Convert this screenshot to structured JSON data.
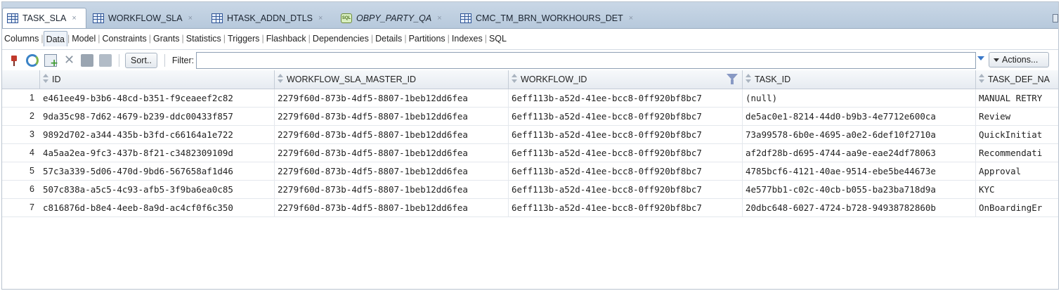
{
  "tabs": [
    {
      "label": "TASK_SLA",
      "icon": "table-grid-icon",
      "active": true
    },
    {
      "label": "WORKFLOW_SLA",
      "icon": "table-grid-icon",
      "active": false
    },
    {
      "label": "HTASK_ADDN_DTLS",
      "icon": "table-grid-icon",
      "active": false
    },
    {
      "label": "OBPY_PARTY_QA",
      "icon": "sql-worksheet-icon",
      "active": false
    },
    {
      "label": "CMC_TM_BRN_WORKHOURS_DET",
      "icon": "table-grid-icon",
      "active": false
    }
  ],
  "subtabs": [
    "Columns",
    "Data",
    "Model",
    "Constraints",
    "Grants",
    "Statistics",
    "Triggers",
    "Flashback",
    "Dependencies",
    "Details",
    "Partitions",
    "Indexes",
    "SQL"
  ],
  "active_subtab": "Data",
  "toolbar": {
    "sort_label": "Sort..",
    "filter_label": "Filter:",
    "filter_value": "",
    "actions_label": "Actions..."
  },
  "columns": [
    "ID",
    "WORKFLOW_SLA_MASTER_ID",
    "WORKFLOW_ID",
    "TASK_ID",
    "TASK_DEF_NA"
  ],
  "rows": [
    {
      "n": "1",
      "cells": [
        "e461ee49-b3b6-48cd-b351-f9ceaeef2c82",
        "2279f60d-873b-4df5-8807-1beb12dd6fea",
        "6eff113b-a52d-41ee-bcc8-0ff920bf8bc7",
        "(null)",
        "MANUAL RETRY"
      ]
    },
    {
      "n": "2",
      "cells": [
        "9da35c98-7d62-4679-b239-ddc00433f857",
        "2279f60d-873b-4df5-8807-1beb12dd6fea",
        "6eff113b-a52d-41ee-bcc8-0ff920bf8bc7",
        "de5ac0e1-8214-44d0-b9b3-4e7712e600ca",
        "Review"
      ]
    },
    {
      "n": "3",
      "cells": [
        "9892d702-a344-435b-b3fd-c66164a1e722",
        "2279f60d-873b-4df5-8807-1beb12dd6fea",
        "6eff113b-a52d-41ee-bcc8-0ff920bf8bc7",
        "73a99578-6b0e-4695-a0e2-6def10f2710a",
        "QuickInitiat"
      ]
    },
    {
      "n": "4",
      "cells": [
        "4a5aa2ea-9fc3-437b-8f21-c3482309109d",
        "2279f60d-873b-4df5-8807-1beb12dd6fea",
        "6eff113b-a52d-41ee-bcc8-0ff920bf8bc7",
        "af2df28b-d695-4744-aa9e-eae24df78063",
        "Recommendati"
      ]
    },
    {
      "n": "5",
      "cells": [
        "57c3a339-5d06-470d-9bd6-567658af1d46",
        "2279f60d-873b-4df5-8807-1beb12dd6fea",
        "6eff113b-a52d-41ee-bcc8-0ff920bf8bc7",
        "4785bcf6-4121-40ae-9514-ebe5be44673e",
        "Approval"
      ]
    },
    {
      "n": "6",
      "cells": [
        "507c838a-a5c5-4c93-afb5-3f9ba6ea0c85",
        "2279f60d-873b-4df5-8807-1beb12dd6fea",
        "6eff113b-a52d-41ee-bcc8-0ff920bf8bc7",
        "4e577bb1-c02c-40cb-b055-ba23ba718d9a",
        "KYC"
      ]
    },
    {
      "n": "7",
      "cells": [
        "c816876d-b8e4-4eeb-8a9d-ac4cf0f6c350",
        "2279f60d-873b-4df5-8807-1beb12dd6fea",
        "6eff113b-a52d-41ee-bcc8-0ff920bf8bc7",
        "20dbc648-6027-4724-b728-94938782860b",
        "OnBoardingEr"
      ]
    }
  ]
}
